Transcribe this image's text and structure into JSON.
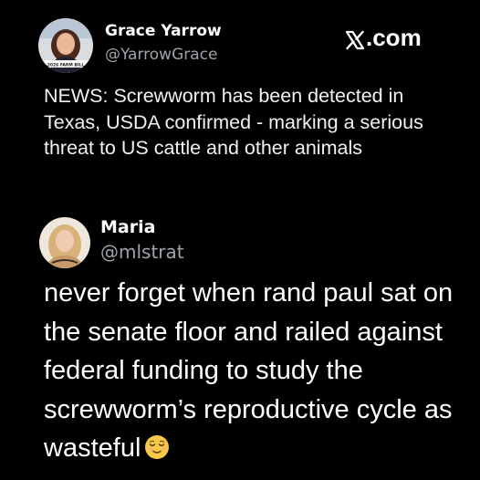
{
  "original_post": {
    "author_name": "Grace Yarrow",
    "author_handle": "@YarrowGrace",
    "avatar_badge_text": "2026 FARM BILL",
    "text": "NEWS: Screwworm has been detected in Texas, USDA confirmed - marking a serious threat to US cattle and other animals"
  },
  "brand": {
    "label": ".com",
    "icon": "x-logo-icon"
  },
  "reply": {
    "author_name": "Maria",
    "author_handle": "@mlstrat",
    "text": "never forget when rand paul sat on the senate floor and railed against federal funding to study the screwworm’s reproductive cycle as wasteful",
    "emoji": "relieved-face-icon"
  },
  "colors": {
    "background": "#000000",
    "text_primary": "#ffffff",
    "text_secondary": "#9ea4aa",
    "emoji_yellow": "#f7c948"
  }
}
